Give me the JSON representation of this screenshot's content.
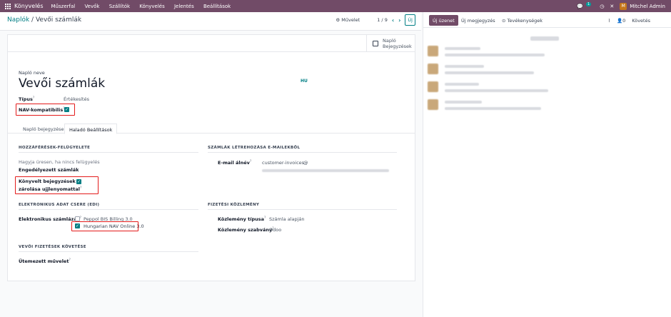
{
  "topbar": {
    "brand": "Könyvelés",
    "menu": [
      "Műszerfal",
      "Vevők",
      "Szállítók",
      "Könyvelés",
      "Jelentés",
      "Beállítások"
    ],
    "chat_count": "1",
    "user_initial": "M",
    "user_name": "Mitchel Admin"
  },
  "control_panel": {
    "breadcrumb_parent": "Naplók",
    "breadcrumb_sep": " / ",
    "breadcrumb_current": "Vevői számlák",
    "action_label": "⚙ Művelet",
    "pager": "1 / 9",
    "new_label": "Új"
  },
  "smart_button": {
    "line1": "Napló",
    "line2": "Bejegyzések"
  },
  "form": {
    "name_label": "Napló neve",
    "name": "Vevői számlák",
    "country_code": "HU",
    "type_label": "Típus",
    "type_value": "Értékesítés",
    "nav_label": "NAV-kompatibilis"
  },
  "tabs": [
    "Napló bejegyzések",
    "Haladó Beállítások"
  ],
  "access": {
    "header": "HOZZÁFÉRÉSEK-FELÜGYELETE",
    "hint": "Hagyja üresen, ha nincs felügyelés",
    "allowed_label": "Engedélyezett számlák",
    "lock_label_line1": "Könyvelt bejegyzések",
    "lock_label_line2": "zárolása ujjlenyomattal"
  },
  "email": {
    "header": "SZÁMLÁK LÉTREHOZÁSA E-MAILEKBŐL",
    "alias_label": "E-mail álnév",
    "alias_value": "customer-invoices",
    "at": "@"
  },
  "edi": {
    "header": "ELEKTRONIKUS ADAT CSERE (EDI)",
    "label": "Elektronikus számlázás",
    "options": [
      {
        "label": "Peppol BIS Billing 3.0",
        "checked": false
      },
      {
        "label": "Hungarian NAV Online 3.0",
        "checked": true
      }
    ]
  },
  "payment_ref": {
    "header": "FIZETÉSI KÖZLEMÉNY",
    "type_label": "Közlemény típusa",
    "type_value": "Számla alapján",
    "standard_label": "Közlemény szabvány",
    "standard_value": "Odoo"
  },
  "followup": {
    "header": "VEVŐI FIZETÉSEK KÖVETÉSE",
    "action_label": "Ütemezett művelet"
  },
  "chatter": {
    "send_message": "Új üzenet",
    "log_note": "Új megjegyzés",
    "activities": "⊙ Tevékenységek",
    "followers": "0",
    "follow": "Követés"
  },
  "colors": {
    "brand": "#714b67",
    "accent": "#017e84",
    "highlight": "#e31b1b"
  }
}
